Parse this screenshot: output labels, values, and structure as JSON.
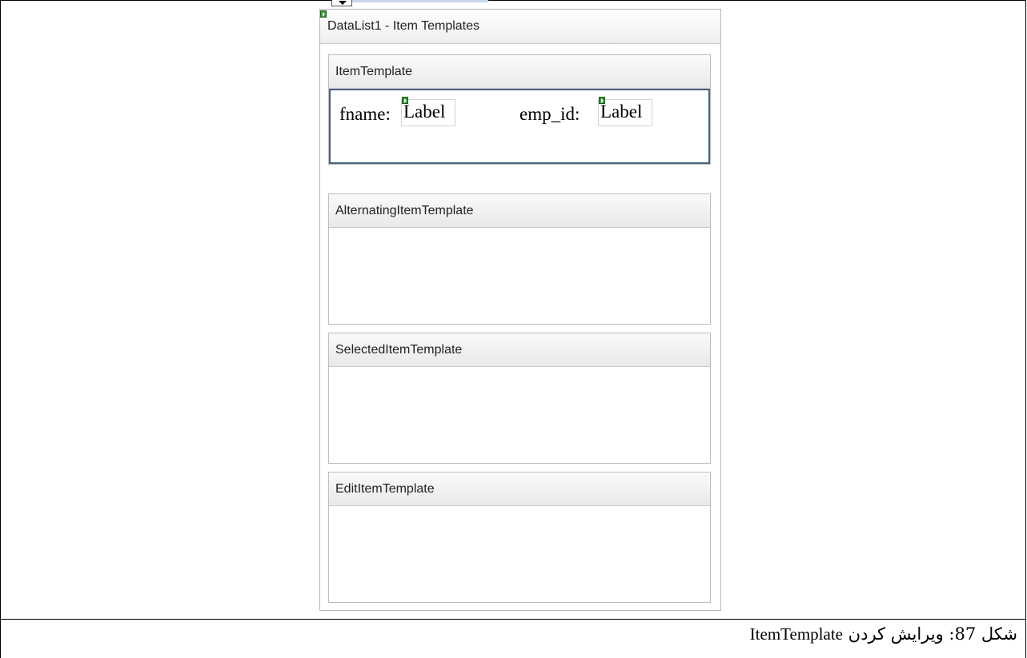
{
  "designer": {
    "title": "DataList1 - Item Templates",
    "sections": [
      {
        "title": "ItemTemplate",
        "fields": [
          {
            "prefix": "fname:",
            "control_text": "Label"
          },
          {
            "prefix": "emp_id:",
            "control_text": "Label"
          }
        ]
      },
      {
        "title": "AlternatingItemTemplate"
      },
      {
        "title": "SelectedItemTemplate"
      },
      {
        "title": "EditItemTemplate"
      }
    ]
  },
  "caption": {
    "persian_text": "شکل 87: ویرایش کردن",
    "english_text": "ItemTemplate"
  },
  "colors": {
    "active_border": "#4a6283",
    "marker_green": "#2f9a2f"
  }
}
